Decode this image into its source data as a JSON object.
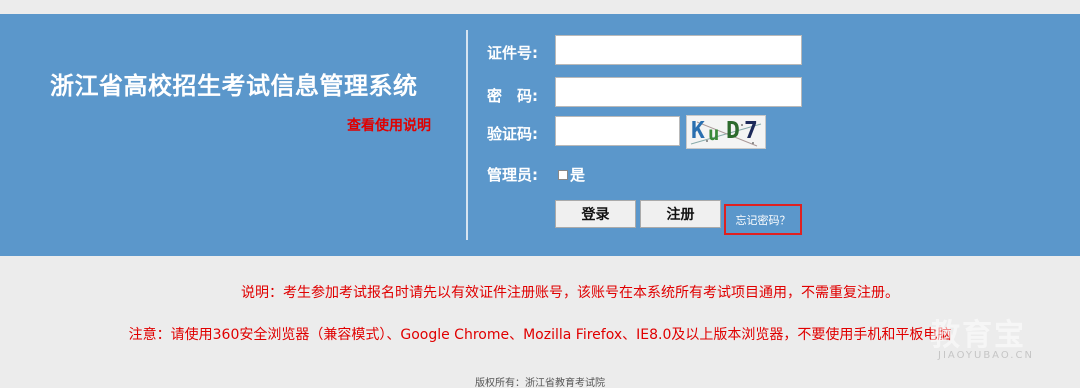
{
  "header": {
    "system_title": "浙江省高校招生考试信息管理系统",
    "help_link": "查看使用说明"
  },
  "login_form": {
    "id_label": "证件号:",
    "id_value": "",
    "password_label": "密　码:",
    "password_value": "",
    "captcha_label": "验证码:",
    "captcha_value": "",
    "captcha_text": "KuD7",
    "admin_label": "管理员:",
    "admin_checkbox_text": "是",
    "login_button": "登录",
    "register_button": "注册",
    "forgot_password": "忘记密码？"
  },
  "notes": {
    "note1": "说明：考生参加考试报名时请先以有效证件注册账号，该账号在本系统所有考试项目通用，不需重复注册。",
    "note2": "注意：请使用360安全浏览器（兼容模式）、Google Chrome、Mozilla Firefox、IE8.0及以上版本浏览器，不要使用手机和平板电脑"
  },
  "footer": {
    "copyright": "版权所有：浙江省教育考试院"
  },
  "watermark": {
    "main": "教育宝",
    "sub": "JIAOYUBAO.CN"
  },
  "colors": {
    "banner": "#5b97cb",
    "page_background": "#ececec",
    "warning_red": "#e00000"
  }
}
